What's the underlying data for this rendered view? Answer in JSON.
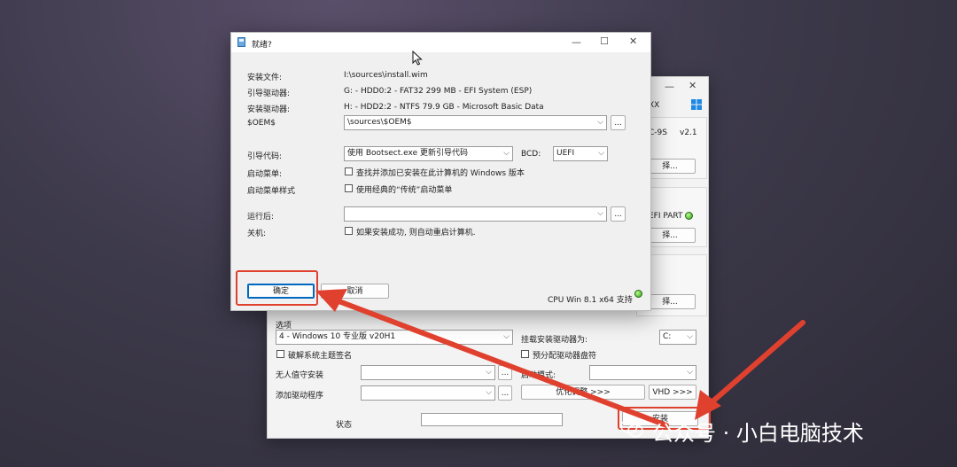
{
  "dialog": {
    "title": "就绪?",
    "rows": {
      "install_file_label": "安装文件:",
      "install_file_value": "I:\\sources\\install.wim",
      "boot_drive_label": "引导驱动器:",
      "boot_drive_value": "G: - HDD0:2 -  FAT32 299 MB - EFI System (ESP)",
      "install_drive_label": "安装驱动器:",
      "install_drive_value": "H: - HDD2:2 -  NTFS 79.9 GB - Microsoft Basic Data",
      "oem_label": "$OEM$",
      "oem_value": "\\sources\\$OEM$",
      "boot_code_label": "引导代码:",
      "boot_code_value": "使用 Bootsect.exe 更新引导代码",
      "bcd_label": "BCD:",
      "bcd_value": "UEFI",
      "boot_menu_label": "启动菜单:",
      "boot_menu_check": "查找并添加已安装在此计算机的 Windows 版本",
      "boot_menu_style_label": "启动菜单样式",
      "boot_menu_style_check": "使用经典的“传统”启动菜单",
      "run_after_label": "运行后:",
      "run_after_value": "",
      "shutdown_label": "关机:",
      "shutdown_check": "如果安装成功, 则自动重启计算机."
    },
    "browse_label": "...",
    "ok_label": "确定",
    "cancel_label": "取消",
    "cpu_support": "CPU Win 8.1 x64 支持"
  },
  "bgwin": {
    "close_glyph": "✕",
    "frag_xx": "XX",
    "frag_c9s": "C-9S",
    "frag_version": "v2.1",
    "frag_select": "择...",
    "frag_efi_part": "EFI PART",
    "options_label": "选项",
    "edition_value": "4 - Windows 10 专业版 v20H1",
    "mount_label": "挂载安装驱动器为:",
    "mount_value": "C:",
    "crack_theme_label": "破解系统主题签名",
    "prealloc_label": "预分配驱动器盘符",
    "unattended_label": "无人值守安装",
    "boot_mode_label": "启动模式:",
    "add_driver_label": "添加驱动程序",
    "tweaks_button": "优化调整 >>>",
    "vhd_button": "VHD >>>",
    "status_label": "状态",
    "install_button": "安装"
  },
  "watermark": "公众号 · 小白电脑技术",
  "accent_color": "#e0412f"
}
